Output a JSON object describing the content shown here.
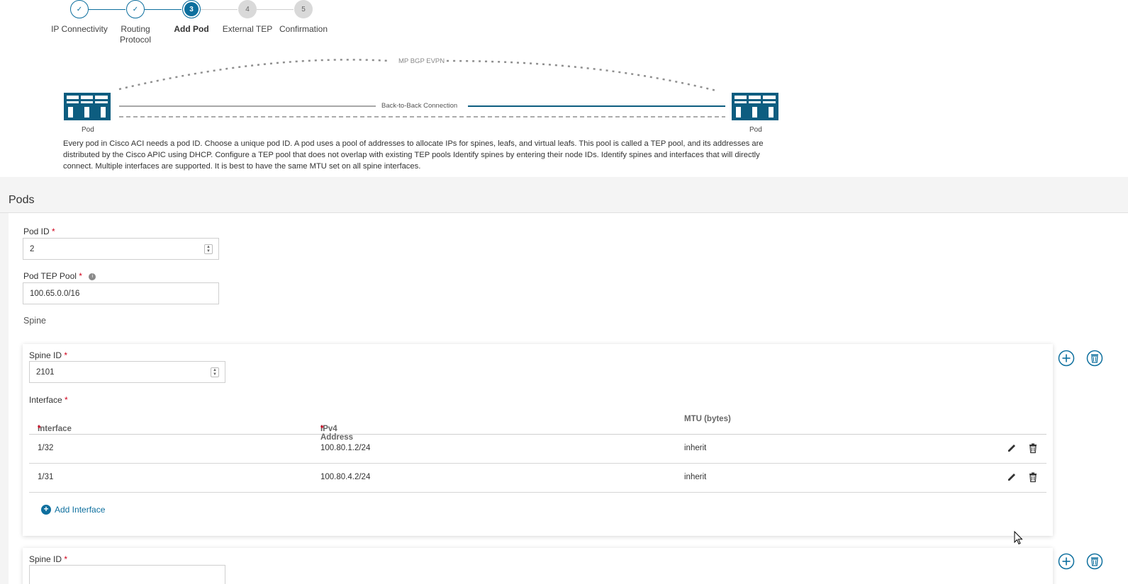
{
  "wizard": {
    "steps": [
      {
        "number": "1",
        "label": "IP Connectivity",
        "state": "done"
      },
      {
        "number": "2",
        "label": "Routing Protocol",
        "state": "done"
      },
      {
        "number": "3",
        "label": "Add Pod",
        "state": "active"
      },
      {
        "number": "4",
        "label": "External TEP",
        "state": "todo"
      },
      {
        "number": "5",
        "label": "Confirmation",
        "state": "todo"
      }
    ],
    "check_glyph": "✓"
  },
  "diagram": {
    "top_arc_label": "MP BGP EVPN",
    "connection_label": "Back-to-Back Connection",
    "left_pod_label": "Pod",
    "right_pod_label": "Pod",
    "accent_color": "#0d5d80"
  },
  "description": "Every pod in Cisco ACI needs a pod ID. Choose a unique pod ID. A pod uses a pool of addresses to allocate IPs for spines, leafs, and virtual leafs. This pool is called a TEP pool, and its addresses are distributed by the Cisco APIC using DHCP. Configure a TEP pool that does not overlap with existing TEP pools Identify spines by entering their node IDs. Identify spines and interfaces that will directly connect. Multiple interfaces are supported. It is best to have the same MTU set on all spine interfaces.",
  "pods": {
    "title": "Pods",
    "pod_id": {
      "label": "Pod ID",
      "required_mark": "*",
      "value": "2"
    },
    "tep_pool": {
      "label": "Pod TEP Pool",
      "required_mark": "*",
      "value": "100.65.0.0/16",
      "info_icon": "info-icon"
    },
    "spine_section_label": "Spine",
    "spines": [
      {
        "id_label": "Spine ID",
        "required_mark": "*",
        "id_value": "2101",
        "interface_label": "Interface",
        "table": {
          "headers": {
            "interface": "Interface",
            "ipv4": "IPv4 Address",
            "mtu": "MTU (bytes)",
            "required_mark": "*"
          },
          "rows": [
            {
              "interface": "1/32",
              "ipv4": "100.80.1.2/24",
              "mtu": "inherit"
            },
            {
              "interface": "1/31",
              "ipv4": "100.80.4.2/24",
              "mtu": "inherit"
            }
          ]
        },
        "add_interface_label": "Add Interface"
      },
      {
        "id_label": "Spine ID",
        "required_mark": "*"
      }
    ]
  },
  "colors": {
    "primary": "#0d6f9e",
    "required": "#d0021b",
    "band": "#f4f4f4"
  }
}
